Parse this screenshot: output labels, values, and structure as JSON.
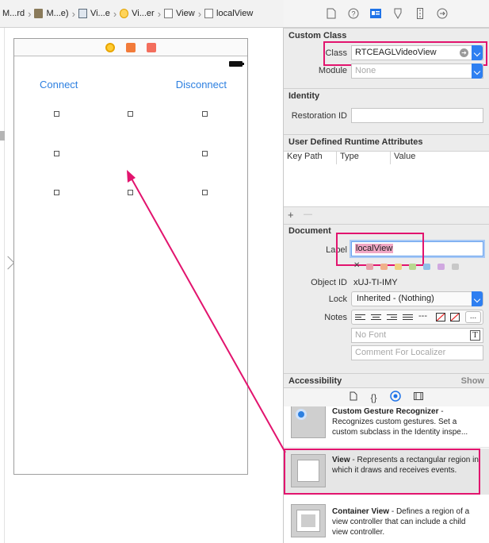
{
  "breadcrumb": {
    "items": [
      {
        "label": "M...rd",
        "icon": "storyboard-icon"
      },
      {
        "label": "M...e)",
        "icon": "document-icon"
      },
      {
        "label": "Vi...e",
        "icon": "scene-icon"
      },
      {
        "label": "Vi...er",
        "icon": "view-controller-icon"
      },
      {
        "label": "View",
        "icon": "view-icon"
      },
      {
        "label": "localView",
        "icon": "view-icon"
      }
    ]
  },
  "canvas": {
    "connect_label": "Connect",
    "disconnect_label": "Disconnect"
  },
  "inspector": {
    "tabs": [
      "file-inspector-icon",
      "help-icon",
      "identity-inspector-icon",
      "attributes-inspector-icon",
      "size-inspector-icon",
      "connections-inspector-icon"
    ],
    "custom_class": {
      "title": "Custom Class",
      "class_label": "Class",
      "class_value": "RTCEAGLVideoView",
      "module_label": "Module",
      "module_placeholder": "None"
    },
    "identity": {
      "title": "Identity",
      "restoration_label": "Restoration ID",
      "restoration_value": ""
    },
    "runtime": {
      "title": "User Defined Runtime Attributes",
      "columns": [
        "Key Path",
        "Type",
        "Value"
      ],
      "add": "+",
      "remove": "—"
    },
    "document": {
      "title": "Document",
      "label_label": "Label",
      "label_value": "localView",
      "clear_mark": "✕",
      "swatches": [
        "#e8a0a8",
        "#f0b08a",
        "#f0d080",
        "#b8d890",
        "#90c0e8",
        "#d0a8e0",
        "#c8c8c8"
      ],
      "object_id_label": "Object ID",
      "object_id_value": "xUJ-TI-IMY",
      "lock_label": "Lock",
      "lock_value": "Inherited - (Nothing)",
      "notes_label": "Notes",
      "more": "...",
      "font_placeholder": "No Font",
      "localizer_placeholder": "Comment For Localizer"
    },
    "accessibility": {
      "title": "Accessibility",
      "show": "Show"
    },
    "library": {
      "items": [
        {
          "title": "Custom Gesture Recognizer",
          "desc": " - Recognizes custom gestures. Set a custom subclass in the Identity inspe..."
        },
        {
          "title": "View",
          "desc": " - Represents a rectangular region in which it draws and receives events."
        },
        {
          "title": "Container View",
          "desc": " - Defines a region of a view controller that can include a child view controller."
        }
      ]
    }
  },
  "colors": {
    "accent": "#1f73e8",
    "highlight": "#e2146e",
    "link": "#2c7fe0"
  }
}
